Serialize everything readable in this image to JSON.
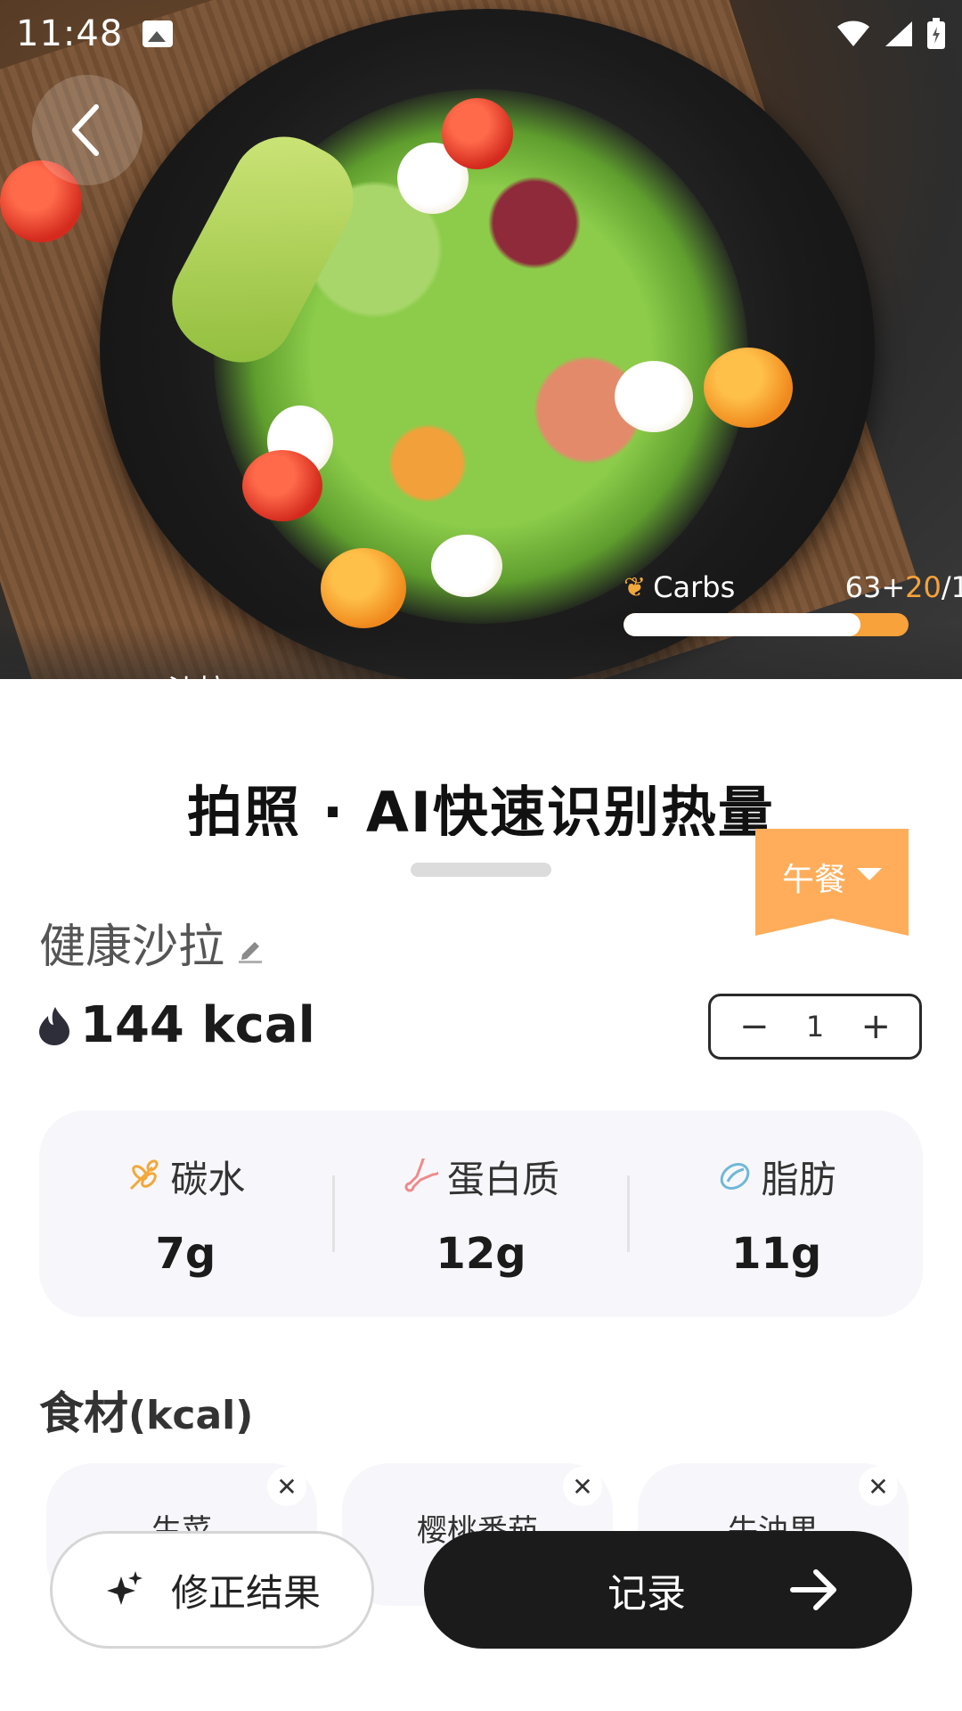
{
  "status_bar": {
    "time": "11:48"
  },
  "hero": {
    "overlay": {
      "label": "Carbs",
      "value_base": "63+",
      "value_added": "20",
      "value_rest": "/1",
      "progress": 0.83
    },
    "peek_text": "沙拉"
  },
  "banner": {
    "title": "拍照 · AI快速识别热量"
  },
  "meal_tag": {
    "label": "午餐"
  },
  "food": {
    "name": "健康沙拉",
    "kcal": "144 kcal"
  },
  "stepper": {
    "minus": "−",
    "quantity": "1",
    "plus": "+"
  },
  "macros": [
    {
      "label": "碳水",
      "value": "7g",
      "icon": "wheat-icon",
      "color": "#f2a93b"
    },
    {
      "label": "蛋白质",
      "value": "12g",
      "icon": "drumstick-icon",
      "color": "#f08a8a"
    },
    {
      "label": "脂肪",
      "value": "11g",
      "icon": "avocado-icon",
      "color": "#6fb8d8"
    }
  ],
  "ingredients": {
    "title": "食材",
    "unit": "(kcal)",
    "items": [
      {
        "name": "生菜"
      },
      {
        "name": "樱桃番茄"
      },
      {
        "name": "牛油果"
      }
    ]
  },
  "actions": {
    "fix_label": "修正结果",
    "record_label": "记录"
  },
  "colors": {
    "accent": "#ffad5a",
    "dark": "#1b1b1b",
    "card": "#f7f7fb"
  }
}
